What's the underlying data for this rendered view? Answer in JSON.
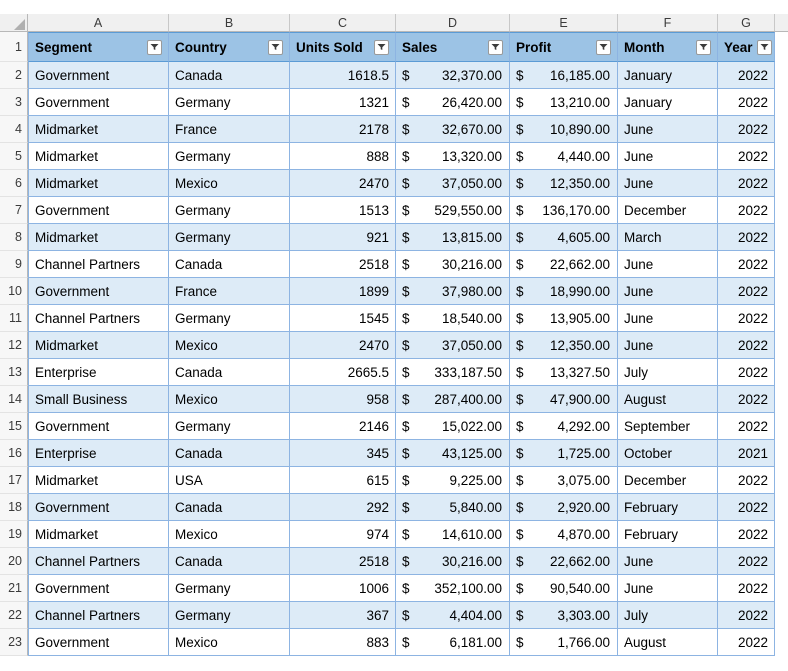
{
  "app": {
    "type": "spreadsheet",
    "select_all_icon": "select-all-triangle-icon",
    "filter_icon": "filter-dropdown-icon"
  },
  "colors": {
    "header_fill": "#9CC3E5",
    "banded_fill": "#DDEBF7",
    "grid_border": "#8DB4E2",
    "header_border": "#5B9BD5",
    "gutter_fill": "#F7F7F7"
  },
  "column_letters": [
    "A",
    "B",
    "C",
    "D",
    "E",
    "F",
    "G"
  ],
  "table": {
    "header_row_number": "1",
    "headers": [
      {
        "label": "Segment",
        "filter": true
      },
      {
        "label": "Country",
        "filter": true
      },
      {
        "label": "Units Sold",
        "filter": true
      },
      {
        "label": "Sales",
        "filter": true
      },
      {
        "label": "Profit",
        "filter": true
      },
      {
        "label": "Month",
        "filter": true
      },
      {
        "label": "Year",
        "filter": true
      }
    ],
    "rows": [
      {
        "n": "2",
        "segment": "Government",
        "country": "Canada",
        "units": "1618.5",
        "sales_sym": "$",
        "sales": "32,370.00",
        "profit_sym": "$",
        "profit": "16,185.00",
        "month": "January",
        "year": "2022"
      },
      {
        "n": "3",
        "segment": "Government",
        "country": "Germany",
        "units": "1321",
        "sales_sym": "$",
        "sales": "26,420.00",
        "profit_sym": "$",
        "profit": "13,210.00",
        "month": "January",
        "year": "2022"
      },
      {
        "n": "4",
        "segment": "Midmarket",
        "country": "France",
        "units": "2178",
        "sales_sym": "$",
        "sales": "32,670.00",
        "profit_sym": "$",
        "profit": "10,890.00",
        "month": "June",
        "year": "2022"
      },
      {
        "n": "5",
        "segment": "Midmarket",
        "country": "Germany",
        "units": "888",
        "sales_sym": "$",
        "sales": "13,320.00",
        "profit_sym": "$",
        "profit": "4,440.00",
        "month": "June",
        "year": "2022"
      },
      {
        "n": "6",
        "segment": "Midmarket",
        "country": "Mexico",
        "units": "2470",
        "sales_sym": "$",
        "sales": "37,050.00",
        "profit_sym": "$",
        "profit": "12,350.00",
        "month": "June",
        "year": "2022"
      },
      {
        "n": "7",
        "segment": "Government",
        "country": "Germany",
        "units": "1513",
        "sales_sym": "$",
        "sales": "529,550.00",
        "profit_sym": "$",
        "profit": "136,170.00",
        "month": "December",
        "year": "2022"
      },
      {
        "n": "8",
        "segment": "Midmarket",
        "country": "Germany",
        "units": "921",
        "sales_sym": "$",
        "sales": "13,815.00",
        "profit_sym": "$",
        "profit": "4,605.00",
        "month": "March",
        "year": "2022"
      },
      {
        "n": "9",
        "segment": "Channel Partners",
        "country": "Canada",
        "units": "2518",
        "sales_sym": "$",
        "sales": "30,216.00",
        "profit_sym": "$",
        "profit": "22,662.00",
        "month": "June",
        "year": "2022"
      },
      {
        "n": "10",
        "segment": "Government",
        "country": "France",
        "units": "1899",
        "sales_sym": "$",
        "sales": "37,980.00",
        "profit_sym": "$",
        "profit": "18,990.00",
        "month": "June",
        "year": "2022"
      },
      {
        "n": "11",
        "segment": "Channel Partners",
        "country": "Germany",
        "units": "1545",
        "sales_sym": "$",
        "sales": "18,540.00",
        "profit_sym": "$",
        "profit": "13,905.00",
        "month": "June",
        "year": "2022"
      },
      {
        "n": "12",
        "segment": "Midmarket",
        "country": "Mexico",
        "units": "2470",
        "sales_sym": "$",
        "sales": "37,050.00",
        "profit_sym": "$",
        "profit": "12,350.00",
        "month": "June",
        "year": "2022"
      },
      {
        "n": "13",
        "segment": "Enterprise",
        "country": "Canada",
        "units": "2665.5",
        "sales_sym": "$",
        "sales": "333,187.50",
        "profit_sym": "$",
        "profit": "13,327.50",
        "month": "July",
        "year": "2022"
      },
      {
        "n": "14",
        "segment": "Small Business",
        "country": "Mexico",
        "units": "958",
        "sales_sym": "$",
        "sales": "287,400.00",
        "profit_sym": "$",
        "profit": "47,900.00",
        "month": "August",
        "year": "2022"
      },
      {
        "n": "15",
        "segment": "Government",
        "country": "Germany",
        "units": "2146",
        "sales_sym": "$",
        "sales": "15,022.00",
        "profit_sym": "$",
        "profit": "4,292.00",
        "month": "September",
        "year": "2022"
      },
      {
        "n": "16",
        "segment": "Enterprise",
        "country": "Canada",
        "units": "345",
        "sales_sym": "$",
        "sales": "43,125.00",
        "profit_sym": "$",
        "profit": "1,725.00",
        "month": "October",
        "year": "2021"
      },
      {
        "n": "17",
        "segment": "Midmarket",
        "country": "USA",
        "units": "615",
        "sales_sym": "$",
        "sales": "9,225.00",
        "profit_sym": "$",
        "profit": "3,075.00",
        "month": "December",
        "year": "2022"
      },
      {
        "n": "18",
        "segment": "Government",
        "country": "Canada",
        "units": "292",
        "sales_sym": "$",
        "sales": "5,840.00",
        "profit_sym": "$",
        "profit": "2,920.00",
        "month": "February",
        "year": "2022"
      },
      {
        "n": "19",
        "segment": "Midmarket",
        "country": "Mexico",
        "units": "974",
        "sales_sym": "$",
        "sales": "14,610.00",
        "profit_sym": "$",
        "profit": "4,870.00",
        "month": "February",
        "year": "2022"
      },
      {
        "n": "20",
        "segment": "Channel Partners",
        "country": "Canada",
        "units": "2518",
        "sales_sym": "$",
        "sales": "30,216.00",
        "profit_sym": "$",
        "profit": "22,662.00",
        "month": "June",
        "year": "2022"
      },
      {
        "n": "21",
        "segment": "Government",
        "country": "Germany",
        "units": "1006",
        "sales_sym": "$",
        "sales": "352,100.00",
        "profit_sym": "$",
        "profit": "90,540.00",
        "month": "June",
        "year": "2022"
      },
      {
        "n": "22",
        "segment": "Channel Partners",
        "country": "Germany",
        "units": "367",
        "sales_sym": "$",
        "sales": "4,404.00",
        "profit_sym": "$",
        "profit": "3,303.00",
        "month": "July",
        "year": "2022"
      },
      {
        "n": "23",
        "segment": "Government",
        "country": "Mexico",
        "units": "883",
        "sales_sym": "$",
        "sales": "6,181.00",
        "profit_sym": "$",
        "profit": "1,766.00",
        "month": "August",
        "year": "2022"
      }
    ]
  }
}
